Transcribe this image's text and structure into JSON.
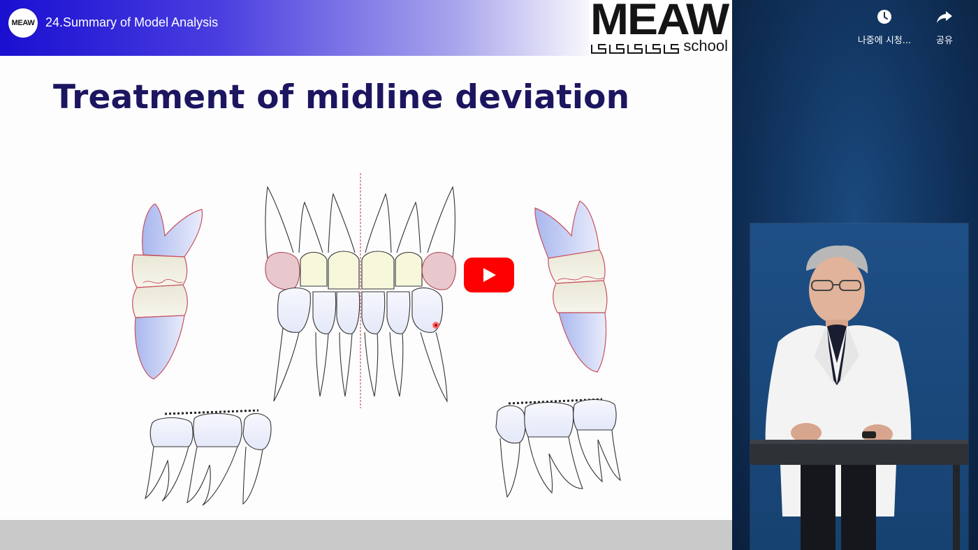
{
  "video": {
    "title": "24.Summary of Model Analysis",
    "channel_avatar_text": "MEAW"
  },
  "slide": {
    "title": "Treatment of midline deviation"
  },
  "brand": {
    "name": "MEAW",
    "sub": "school"
  },
  "actions": {
    "watch_later_label": "나중에 시청...",
    "share_label": "공유"
  },
  "colors": {
    "title": "#1c1660",
    "play_button": "#ff0000",
    "presenter_bg": "#123561"
  },
  "icons": {
    "watch_later": "clock-icon",
    "share": "share-arrow-icon",
    "play": "play-icon"
  }
}
